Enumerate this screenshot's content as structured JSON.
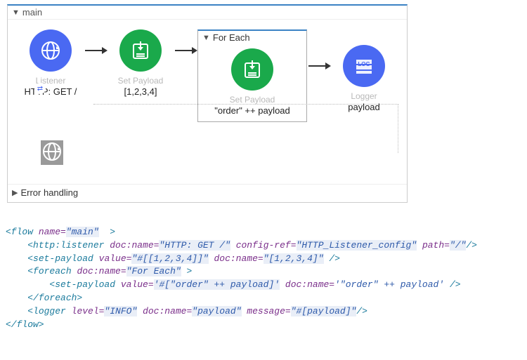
{
  "flow": {
    "name": "main",
    "errorSection": "Error handling",
    "nodes": {
      "listener": {
        "label": "Listener",
        "caption": "HTTP: GET /"
      },
      "setPayload1": {
        "label": "Set Payload",
        "caption": "[1,2,3,4]"
      },
      "foreach": {
        "title": "For Each",
        "inner": {
          "label": "Set Payload",
          "caption": "\"order\" ++ payload"
        }
      },
      "logger": {
        "label": "Logger",
        "caption": "payload"
      }
    }
  },
  "xml": {
    "l1_open": "<flow ",
    "l1_attr": "name=",
    "l1_val": "\"main\"",
    "l1_close": "  >",
    "l2_open": "<http:listener ",
    "l2_a1": "doc:name=",
    "l2_v1": "\"HTTP: GET /\"",
    "l2_a2": " config-ref=",
    "l2_v2": "\"HTTP_Listener_config\"",
    "l2_a3": " path=",
    "l2_v3": "\"/\"",
    "l2_close": "/>",
    "l3_open": "<set-payload ",
    "l3_a1": "value=",
    "l3_v1": "\"#[[1,2,3,4]]\"",
    "l3_a2": " doc:name=",
    "l3_v2": "\"[1,2,3,4]\"",
    "l3_close": " />",
    "l4_open": "<foreach ",
    "l4_a1": "doc:name=",
    "l4_v1": "\"For Each\"",
    "l4_close": " >",
    "l5_open": "<set-payload ",
    "l5_a1": "value=",
    "l5_v1": "'#[\"order\" ++ payload]'",
    "l5_a2": " doc:name=",
    "l5_v2": "'\"order\" ++ payload'",
    "l5_close": " />",
    "l6": "</foreach>",
    "l7_open": "<logger ",
    "l7_a1": "level=",
    "l7_v1": "\"INFO\"",
    "l7_a2": " doc:name=",
    "l7_v2": "\"payload\"",
    "l7_a3": " message=",
    "l7_v3": "\"#[payload]\"",
    "l7_close": "/>",
    "l8": "</flow>"
  }
}
